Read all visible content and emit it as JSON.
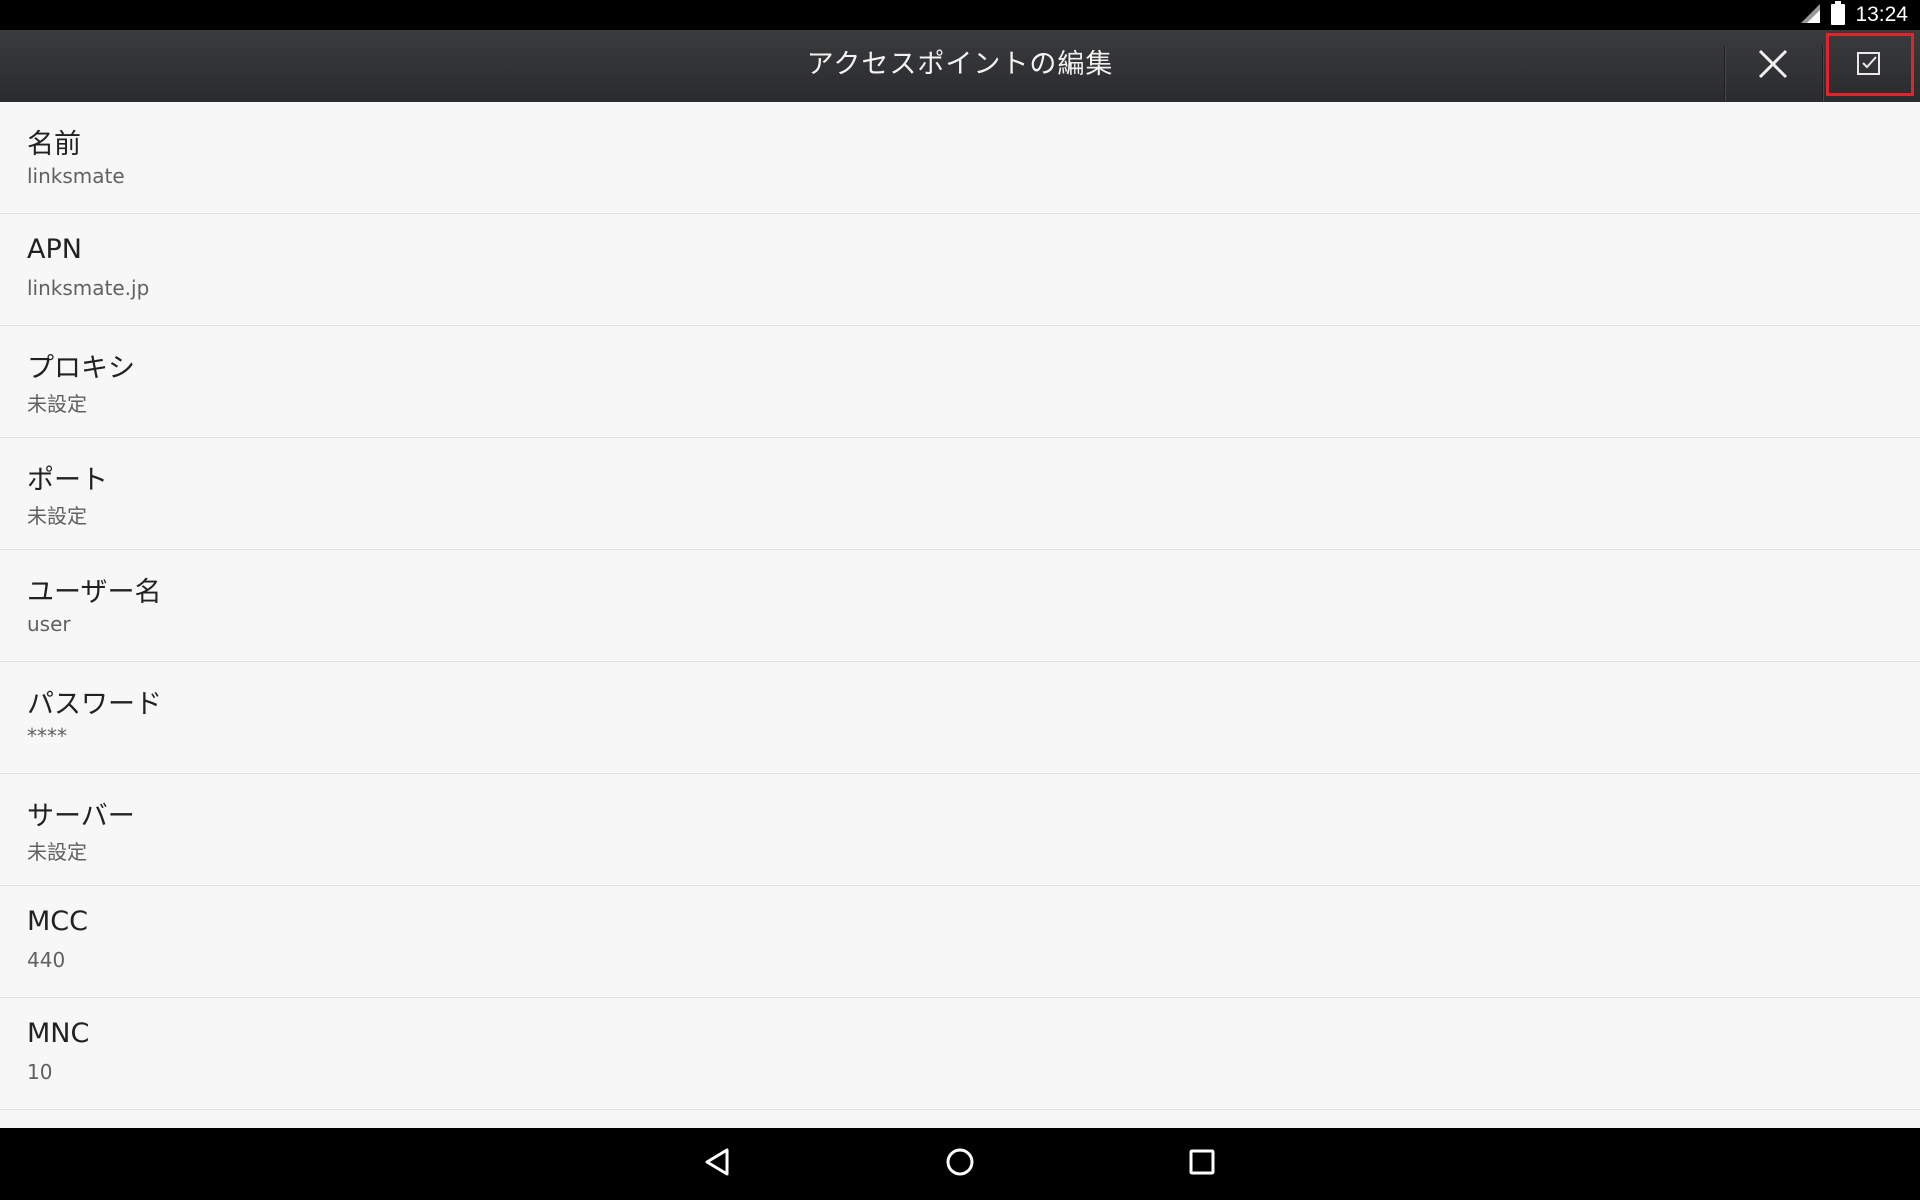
{
  "status_bar": {
    "time": "13:24",
    "icons": [
      "signal-icon",
      "battery-icon"
    ]
  },
  "app_bar": {
    "title": "アクセスポイントの編集",
    "actions": [
      "close-icon",
      "checkbox-check-icon"
    ]
  },
  "fields": [
    {
      "label": "名前",
      "value": "linksmate"
    },
    {
      "label": "APN",
      "value": "linksmate.jp"
    },
    {
      "label": "プロキシ",
      "value": "未設定"
    },
    {
      "label": "ポート",
      "value": "未設定"
    },
    {
      "label": "ユーザー名",
      "value": "user"
    },
    {
      "label": "パスワード",
      "value": "****"
    },
    {
      "label": "サーバー",
      "value": "未設定"
    },
    {
      "label": "MCC",
      "value": "440"
    },
    {
      "label": "MNC",
      "value": "10"
    }
  ],
  "nav_bar": {
    "buttons": [
      "back-icon",
      "home-icon",
      "recents-icon"
    ]
  },
  "colors": {
    "highlight": "#e0242b",
    "app_bar": "#323335",
    "background": "#f7f7f7"
  }
}
